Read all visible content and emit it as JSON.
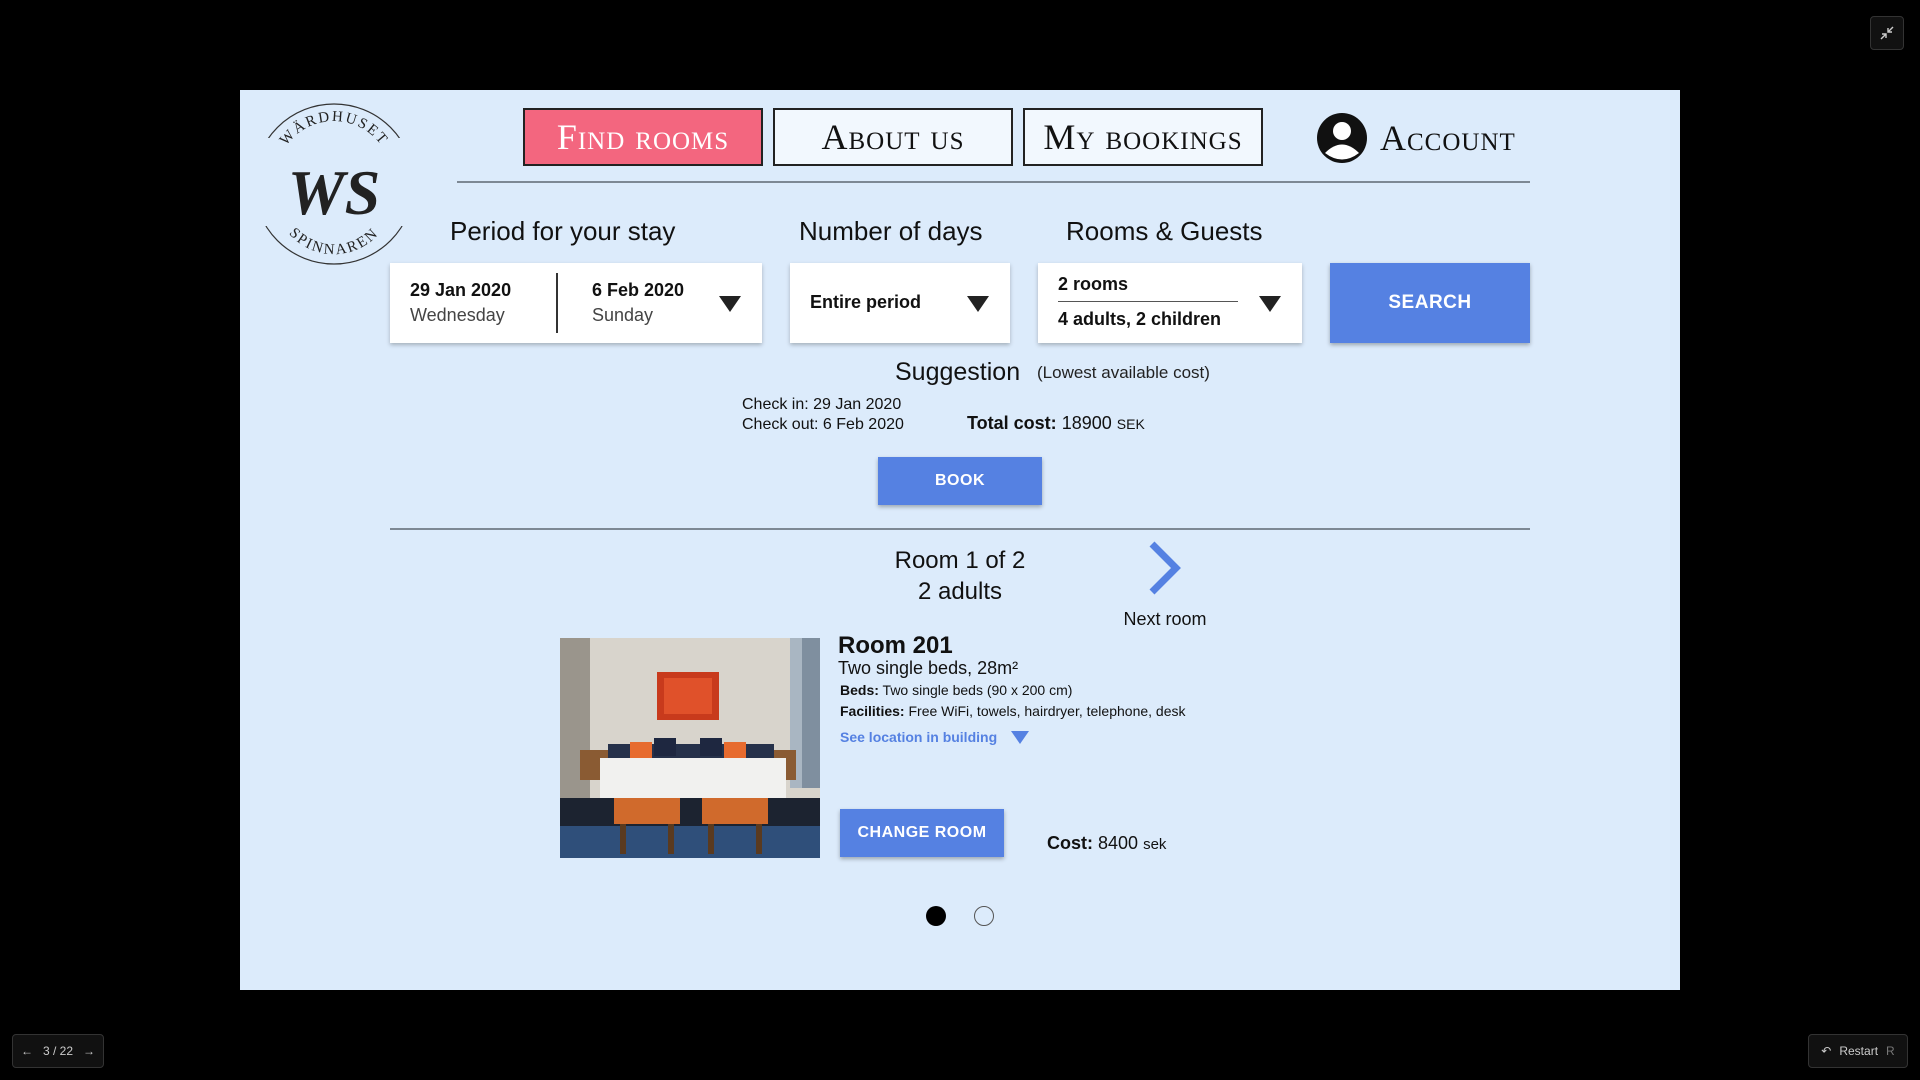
{
  "logo": {
    "top_text": "WÄRDHUSET",
    "monogram": "WS",
    "bottom_text": "SPINNAREN"
  },
  "nav": {
    "find_rooms": "Find rooms",
    "about_us": "About us",
    "my_bookings": "My bookings",
    "account": "Account"
  },
  "search": {
    "period_label": "Period for your stay",
    "days_label": "Number of days",
    "guests_label": "Rooms & Guests",
    "check_in_date": "29 Jan 2020",
    "check_in_day": "Wednesday",
    "check_out_date": "6 Feb 2020",
    "check_out_day": "Sunday",
    "days_value": "Entire period",
    "rooms_value": "2 rooms",
    "guests_value": "4 adults, 2 children",
    "search_button": "SEARCH"
  },
  "suggestion": {
    "title": "Suggestion",
    "subtitle": "(Lowest available cost)",
    "check_in": "Check in: 29 Jan 2020",
    "check_out": "Check out: 6 Feb 2020",
    "total_label": "Total cost:",
    "total_value": "18900",
    "total_unit": "SEK",
    "book_button": "BOOK"
  },
  "room_pager": {
    "counter": "Room 1 of 2",
    "guests": "2 adults",
    "next_label": "Next room"
  },
  "room": {
    "name": "Room 201",
    "summary": "Two single beds, 28m²",
    "beds_label": "Beds:",
    "beds_value": "Two single beds (90 x 200 cm)",
    "facilities_label": "Facilities:",
    "facilities_value": "Free WiFi, towels, hairdryer, telephone, desk",
    "location_link": "See location in building",
    "change_button": "CHANGE ROOM",
    "cost_label": "Cost:",
    "cost_value": "8400",
    "cost_unit": "sek"
  },
  "viewer": {
    "page_counter": "3 / 22",
    "restart_label": "Restart",
    "restart_key": "R"
  },
  "colors": {
    "accent": "#5581e2",
    "nav_active": "#f3667f",
    "canvas": "#dcebfb"
  }
}
